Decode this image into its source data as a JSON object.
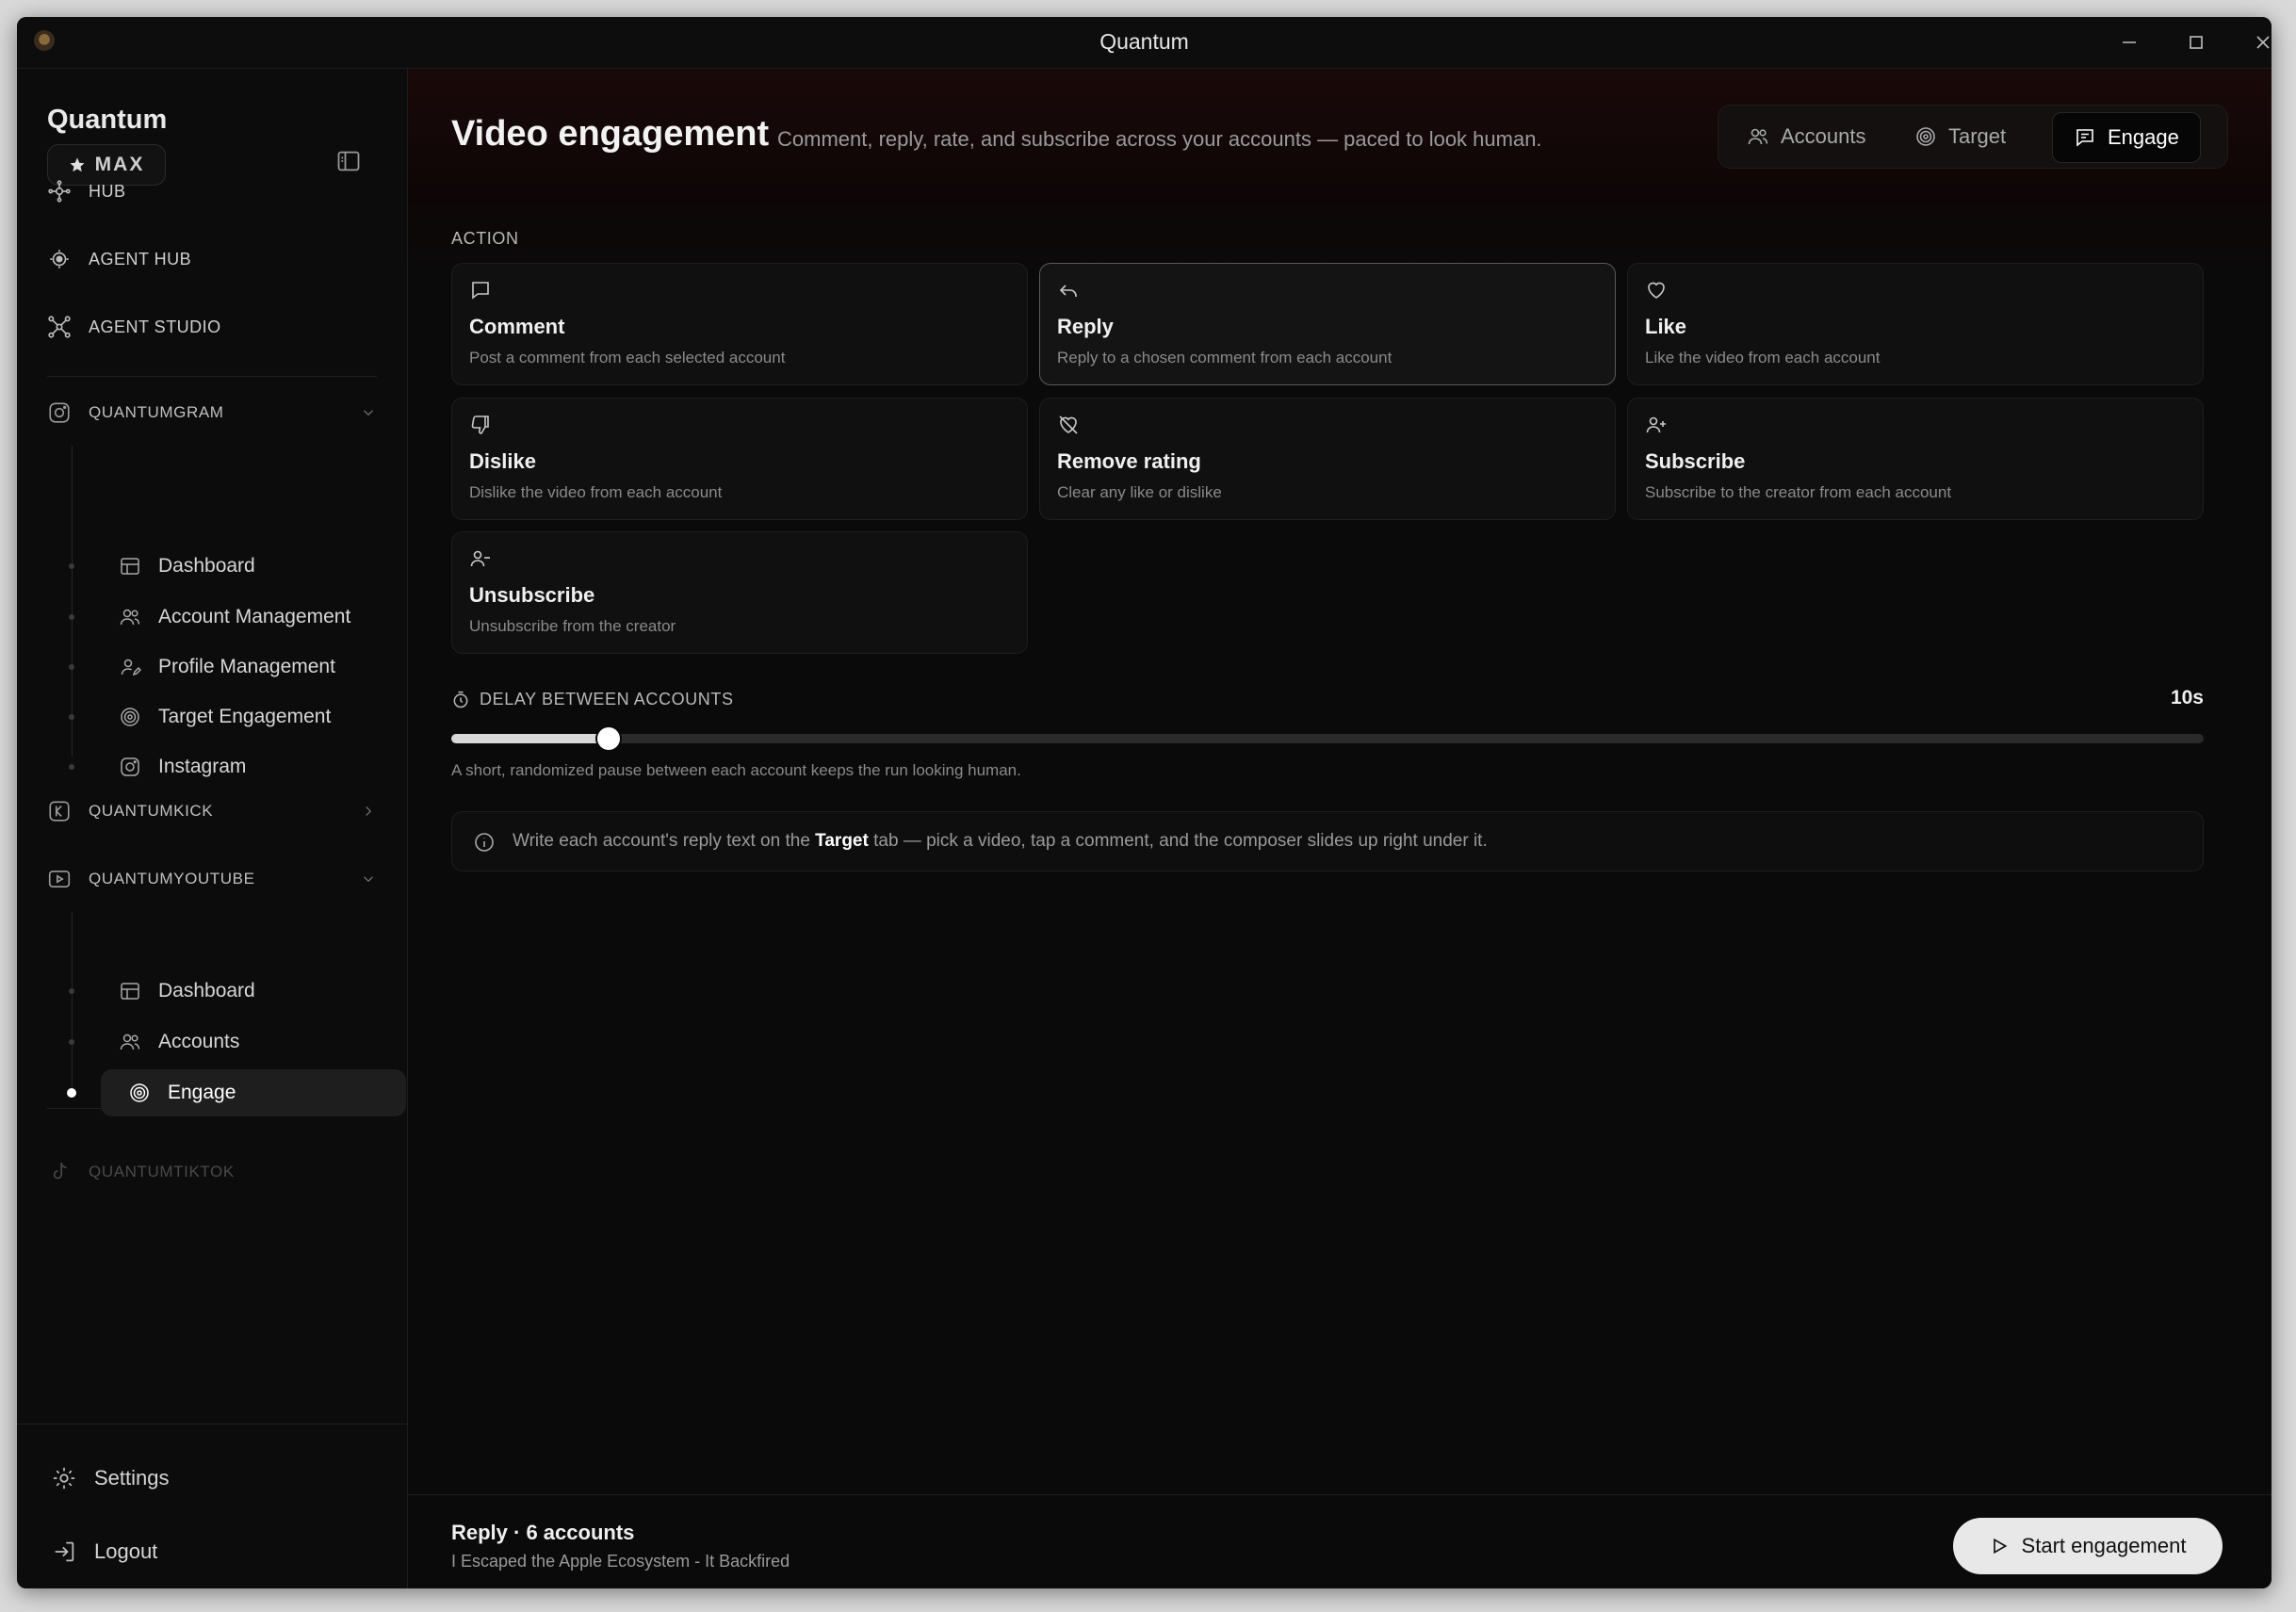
{
  "window": {
    "title": "Quantum"
  },
  "sidebar": {
    "brand": "Quantum",
    "plan": "MAX",
    "top_nav": [
      {
        "label": "HUB",
        "icon": "hub-icon"
      },
      {
        "label": "AGENT HUB",
        "icon": "agent-hub-icon"
      },
      {
        "label": "AGENT STUDIO",
        "icon": "agent-studio-icon"
      }
    ],
    "sections": [
      {
        "label": "QUANTUMGRAM",
        "icon": "instagram-icon",
        "expanded": true,
        "items": [
          {
            "label": "Dashboard",
            "icon": "dashboard-icon"
          },
          {
            "label": "Account Management",
            "icon": "users-icon"
          },
          {
            "label": "Profile Management",
            "icon": "user-edit-icon"
          },
          {
            "label": "Target Engagement",
            "icon": "target-icon"
          },
          {
            "label": "Instagram",
            "icon": "instagram-icon"
          }
        ]
      },
      {
        "label": "QUANTUMKICK",
        "icon": "kick-icon",
        "expanded": false
      },
      {
        "label": "QUANTUMYOUTUBE",
        "icon": "youtube-icon",
        "expanded": true,
        "items": [
          {
            "label": "Dashboard",
            "icon": "dashboard-icon"
          },
          {
            "label": "Accounts",
            "icon": "users-icon"
          },
          {
            "label": "Engage",
            "icon": "target-icon",
            "active": true
          }
        ]
      },
      {
        "label": "QUANTUMTIKTOK",
        "icon": "tiktok-icon",
        "disabled": true
      }
    ],
    "footer": {
      "settings": "Settings",
      "logout": "Logout"
    }
  },
  "main": {
    "title": "Video engagement",
    "subtitle": "Comment, reply, rate, and subscribe across your accounts — paced to look human.",
    "tabs": [
      {
        "label": "Accounts",
        "icon": "users-icon"
      },
      {
        "label": "Target",
        "icon": "target-icon"
      },
      {
        "label": "Engage",
        "icon": "message-icon",
        "active": true
      }
    ],
    "action_label": "ACTION",
    "actions": [
      {
        "title": "Comment",
        "desc": "Post a comment from each selected account",
        "icon": "comment-icon"
      },
      {
        "title": "Reply",
        "desc": "Reply to a chosen comment from each account",
        "icon": "reply-icon",
        "selected": true
      },
      {
        "title": "Like",
        "desc": "Like the video from each account",
        "icon": "heart-icon"
      },
      {
        "title": "Dislike",
        "desc": "Dislike the video from each account",
        "icon": "thumbs-down-icon"
      },
      {
        "title": "Remove rating",
        "desc": "Clear any like or dislike",
        "icon": "heart-off-icon"
      },
      {
        "title": "Subscribe",
        "desc": "Subscribe to the creator from each account",
        "icon": "user-plus-icon"
      },
      {
        "title": "Unsubscribe",
        "desc": "Unsubscribe from the creator",
        "icon": "user-minus-icon"
      }
    ],
    "delay": {
      "label": "DELAY BETWEEN ACCOUNTS",
      "value_text": "10s",
      "fraction": 0.09,
      "hint": "A short, randomized pause between each account keeps the run looking human."
    },
    "info": {
      "before": "Write each account's reply text on the ",
      "bold": "Target",
      "after": " tab — pick a video, tap a comment, and the composer slides up right under it."
    },
    "footer": {
      "summary": "Reply · 6 accounts",
      "video": "I Escaped the Apple Ecosystem - It Backfired",
      "start_label": "Start engagement"
    }
  }
}
